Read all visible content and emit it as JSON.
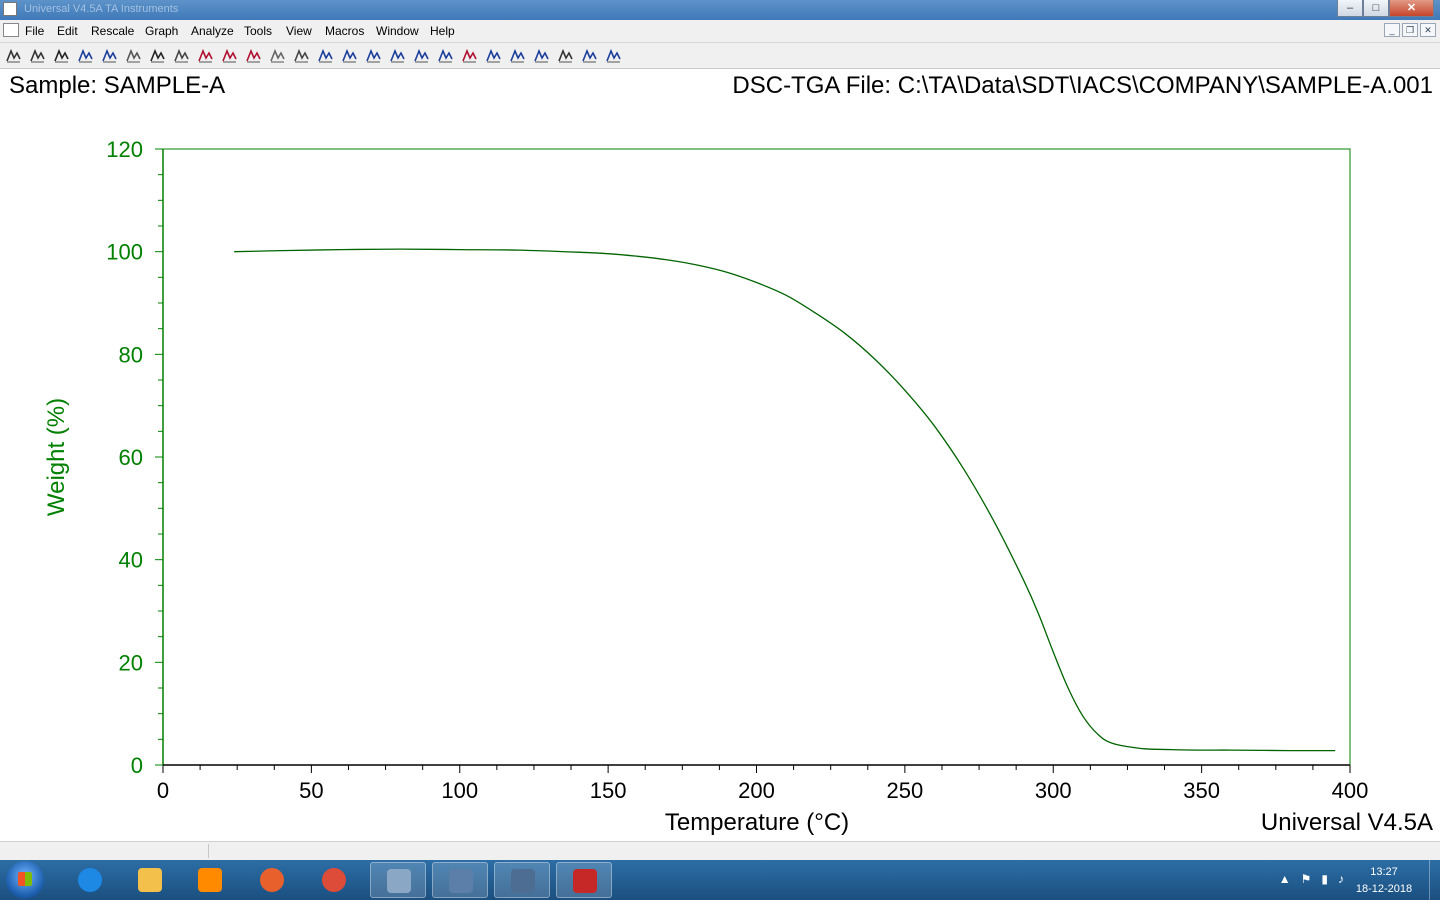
{
  "window": {
    "title": "Universal V4.5A TA Instruments",
    "controls": {
      "minimize": "–",
      "maximize": "□",
      "close": "✕"
    }
  },
  "menubar": {
    "items": [
      "File",
      "Edit",
      "Rescale",
      "Graph",
      "Analyze",
      "Tools",
      "View",
      "Macros",
      "Window",
      "Help"
    ]
  },
  "toolbar": {
    "icons": [
      "open-icon",
      "print-icon",
      "cursor-icon",
      "rescale-icon",
      "graph-icon",
      "format-icon",
      "refresh-icon",
      "copy-icon",
      "crosshair-icon",
      "signal-icon",
      "peak-icon",
      "scale-icon",
      "label-icon",
      "marks-icon",
      "onset-icon",
      "step-icon",
      "integrate-icon",
      "peak-max-icon",
      "derivative-icon",
      "limits-icon",
      "slope-icon",
      "transition-icon",
      "crossover-icon",
      "table-icon",
      "curve-icon",
      "report-icon"
    ]
  },
  "header": {
    "sample": "Sample: SAMPLE-A",
    "file": "DSC-TGA File: C:\\TA\\Data\\SDT\\IACS\\COMPANY\\SAMPLE-A.001"
  },
  "chart_data": {
    "type": "line",
    "xlabel": "Temperature (°C)",
    "ylabel": "Weight (%)",
    "xlim": [
      0,
      400
    ],
    "ylim": [
      0,
      120
    ],
    "xticks": [
      "0",
      "50",
      "100",
      "150",
      "200",
      "250",
      "300",
      "350",
      "400"
    ],
    "yticks": [
      "0",
      "20",
      "40",
      "60",
      "80",
      "100",
      "120"
    ],
    "series": [
      {
        "color": "#006400",
        "x": [
          24,
          40,
          60,
          80,
          100,
          120,
          140,
          150,
          160,
          170,
          180,
          190,
          200,
          210,
          220,
          230,
          240,
          250,
          260,
          270,
          280,
          290,
          295,
          300,
          305,
          310,
          315,
          320,
          330,
          340,
          350,
          360,
          380,
          395
        ],
        "y": [
          100.0,
          100.2,
          100.4,
          100.5,
          100.4,
          100.3,
          99.9,
          99.6,
          99.1,
          98.4,
          97.4,
          96.0,
          94.0,
          91.5,
          88.0,
          84.0,
          79.0,
          73.0,
          66.0,
          57.5,
          47.5,
          36.0,
          29.5,
          22.0,
          15.0,
          9.5,
          6.0,
          4.2,
          3.2,
          3.0,
          2.9,
          2.9,
          2.8,
          2.8
        ]
      }
    ],
    "footer": "Universal V4.5A"
  },
  "taskbar": {
    "items": [
      "start-button",
      "internet-explorer-icon",
      "file-explorer-icon",
      "media-player-icon",
      "firefox-icon",
      "chrome-icon",
      "ta-explorer-icon",
      "ta-universal-icon",
      "instrument-control-icon",
      "universal-analysis-icon"
    ],
    "time": "13:27",
    "date": "18-12-2018"
  }
}
